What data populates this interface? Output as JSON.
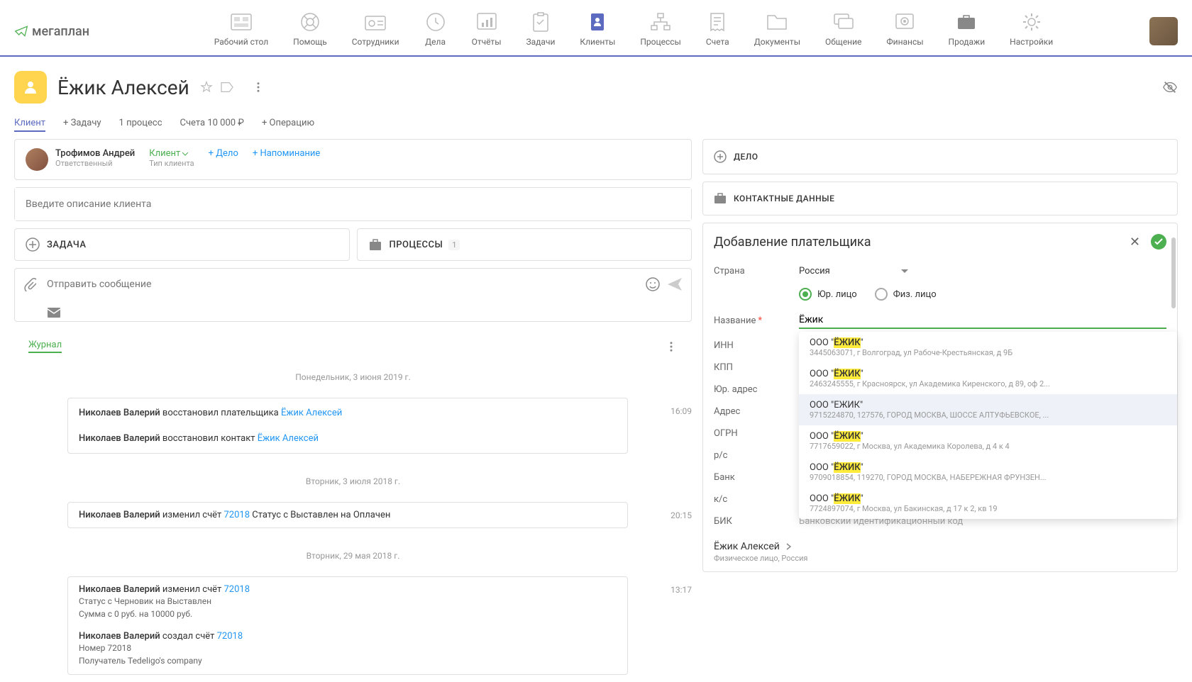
{
  "logo": "мегаплан",
  "nav": [
    {
      "label": "Рабочий стол"
    },
    {
      "label": "Помощь"
    },
    {
      "label": "Сотрудники"
    },
    {
      "label": "Дела"
    },
    {
      "label": "Отчёты"
    },
    {
      "label": "Задачи"
    },
    {
      "label": "Клиенты"
    },
    {
      "label": "Процессы"
    },
    {
      "label": "Счета"
    },
    {
      "label": "Документы"
    },
    {
      "label": "Общение"
    },
    {
      "label": "Финансы"
    },
    {
      "label": "Продажи"
    },
    {
      "label": "Настройки"
    }
  ],
  "client_name": "Ёжик Алексей",
  "tabs": {
    "client": "Клиент",
    "task": "+ Задачу",
    "process": "1 процесс",
    "invoice": "Счета 10 000 ₽",
    "operation": "+ Операцию"
  },
  "owner": {
    "name": "Трофимов Андрей",
    "role": "Ответственный",
    "type": "Клиент",
    "type_sub": "Тип клиента",
    "add_deal": "+ Дело",
    "add_reminder": "+ Напоминание"
  },
  "desc_placeholder": "Введите описание клиента",
  "task_label": "ЗАДАЧА",
  "process_label": "ПРОЦЕССЫ",
  "process_count": "1",
  "msg_placeholder": "Отправить сообщение",
  "journal": "Журнал",
  "dates": {
    "d1": "Понедельник, 3 июня 2019 г.",
    "d2": "Вторник, 3 июля 2018 г.",
    "d3": "Вторник, 29 мая 2018 г."
  },
  "log": {
    "e1": {
      "actor": "Николаев Валерий",
      "text": " восстановил плательщика ",
      "link": "Ёжик Алексей",
      "time": "16:09"
    },
    "e2": {
      "actor": "Николаев Валерий",
      "text": " восстановил контакт ",
      "link": "Ёжик Алексей"
    },
    "e3": {
      "actor": "Николаев Валерий",
      "text": " изменил счёт ",
      "link": "72018",
      "tail": "   Статус   с Выставлен на Оплачен",
      "time": "20:15"
    },
    "e4": {
      "actor": "Николаев Валерий",
      "text": " изменил счёт ",
      "link": "72018",
      "time": "13:17",
      "d1": "Статус   с Черновик на Выставлен",
      "d2": "Сумма   с 0 руб. на 10000 руб."
    },
    "e5": {
      "actor": "Николаев Валерий",
      "text": " создал счёт ",
      "link": "72018",
      "d1": "Номер   72018",
      "d2": "Получатель   Tedeligo's company"
    }
  },
  "right": {
    "deal": "ДЕЛО",
    "contacts": "КОНТАКТНЫЕ ДАННЫЕ",
    "payer_title": "Добавление плательщика",
    "country_label": "Страна",
    "country_value": "Россия",
    "legal": "Юр. лицо",
    "individual": "Физ. лицо",
    "name_label": "Название",
    "name_value": "Ёжик",
    "inn": "ИНН",
    "kpp": "КПП",
    "legal_addr": "Юр. адрес",
    "addr": "Адрес",
    "ogrn": "ОГРН",
    "rs": "р/с",
    "bank": "Банк",
    "ks": "к/с",
    "bik": "БИК",
    "bik_ph": "Банковский идентификационный код",
    "payer_name": "Ёжик Алексей",
    "payer_sub": "Физическое лицо, Россия"
  },
  "suggestions": [
    {
      "pre": "ООО \"",
      "hl": "ЁЖИК",
      "post": "\"",
      "addr": "3445063071, г Волгоград, ул Рабоче-Крестьянская, д 9Б"
    },
    {
      "pre": "ООО \"",
      "hl": "ЁЖИК",
      "post": "\"",
      "addr": "2463245555, г Красноярск, ул Академика Киренского, д 89, оф 2..."
    },
    {
      "pre": "ООО \"ЕЖИК\"",
      "hl": "",
      "post": "",
      "addr": "9715224870, 127576, ГОРОД МОСКВА, ШОССЕ АЛТУФЬЕВСКОЕ, ..."
    },
    {
      "pre": "ООО \"",
      "hl": "ЁЖИК",
      "post": "\"",
      "addr": "7717659022, г Москва, ул Академика Королева, д 4 к 4"
    },
    {
      "pre": "ООО \"",
      "hl": "ЁЖИК",
      "post": "\"",
      "addr": "9709018854, 119270, ГОРОД МОСКВА, НАБЕРЕЖНАЯ ФРУНЗЕН..."
    },
    {
      "pre": "ООО \"",
      "hl": "ЁЖИК",
      "post": "\"",
      "addr": "7724897074, г Москва, ул Бакинская, д 17 к 2, кв 19"
    }
  ]
}
